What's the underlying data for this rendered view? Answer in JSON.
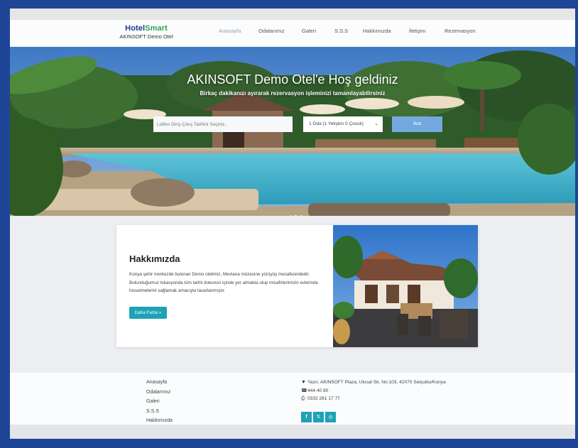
{
  "brand": {
    "logo_part1": "Hotel",
    "logo_part2": "Smart",
    "subtitle": "AKINSOFT Demo Otel"
  },
  "nav": {
    "items": [
      "Anasayfa",
      "Odalarımız",
      "Galeri",
      "S.S.S",
      "Hakkımızda",
      "İletişim",
      "Rezervasyon"
    ],
    "active_index": 0
  },
  "hero": {
    "title": "AKINSOFT Demo Otel'e Hoş geldiniz",
    "subtitle": "Birkaç dakikanızı ayırarak rezervasyon işleminizi tamamlayabilirsiniz",
    "date_placeholder": "Lütfen Giriş-Çıkış Tarihini Seçiniz..",
    "room_select_value": "1 Oda (1 Yetişkin 0 Çocuk)",
    "search_label": "Ara",
    "carousel_active": 1
  },
  "about": {
    "title": "Hakkımızda",
    "text": "Konya şehir merkezde bulunan Demo otelimiz, Mevlana müzesine yürüyüş mesafesindedir. Bulunduğumuz lokasyonda tüm tarihi dokunun içinde yer almakta olup misafirlerimizin evlerinde hissetmelerini sağlamak amacıyla tasarlanmıştır.",
    "button_label": "Daha Fazla »"
  },
  "footer": {
    "links": [
      "Anasayfa",
      "Odalarımız",
      "Galeri",
      "S.S.S",
      "Hakkımızda"
    ],
    "address": "Yazır, AKINSOFT Plaza, Ulusal Sk. No:103, 42070 Selçuklu/Konya",
    "phone": "444 40 80",
    "fax": "0332 261 17 77",
    "social": [
      "facebook",
      "twitter",
      "instagram"
    ]
  },
  "colors": {
    "accent": "#1ea3b5",
    "search_button": "#74a8e0",
    "brand_blue": "#1b3f8b",
    "brand_green": "#2ea44f",
    "frame_border": "#1f4596"
  }
}
